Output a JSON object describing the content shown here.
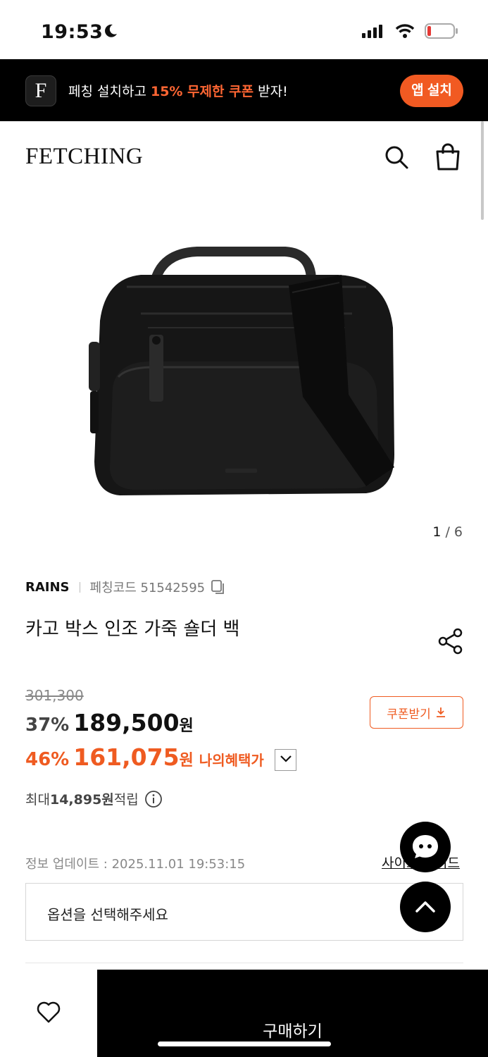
{
  "status_bar": {
    "time": "19:53"
  },
  "promo": {
    "logo_letter": "F",
    "text_prefix": "페칭 설치하고 ",
    "text_accent": "15% 무제한 쿠폰",
    "text_suffix": " 받자!",
    "button_label": "앱 설치",
    "accent_color": "#f15a22"
  },
  "header": {
    "logo": "FETCHING"
  },
  "gallery": {
    "current": "1",
    "separator": "/",
    "total": "6"
  },
  "product": {
    "brand": "RAINS",
    "code_label": "페칭코드 51542595",
    "title": "카고 박스 인조 가죽 숄더 백",
    "original_price": "301,300",
    "discount_pct": "37%",
    "price": "189,500",
    "currency": "원",
    "benefit_pct": "46%",
    "benefit_price": "161,075",
    "benefit_label": "나의혜택가",
    "coupon_button": "쿠폰받기",
    "points_prefix": "최대 ",
    "points_amount": "14,895원",
    "points_suffix": " 적립",
    "update_text": "정보 업데이트 : 2025.11.01 19:53:15",
    "size_guide": "사이즈 가이드",
    "option_placeholder": "옵션을 선택해주세요"
  },
  "bottom_bar": {
    "buy_label": "구매하기"
  },
  "icons": {
    "moon": "moon-icon",
    "signal": "signal-icon",
    "wifi": "wifi-icon",
    "battery": "battery-icon",
    "search": "search-icon",
    "bag": "shopping-bag-icon",
    "copy": "copy-icon",
    "share": "share-icon",
    "download": "download-icon",
    "info": "info-icon",
    "chevron": "chevron-down-icon",
    "chat": "chat-icon",
    "up": "chevron-up-icon",
    "heart": "heart-icon"
  }
}
